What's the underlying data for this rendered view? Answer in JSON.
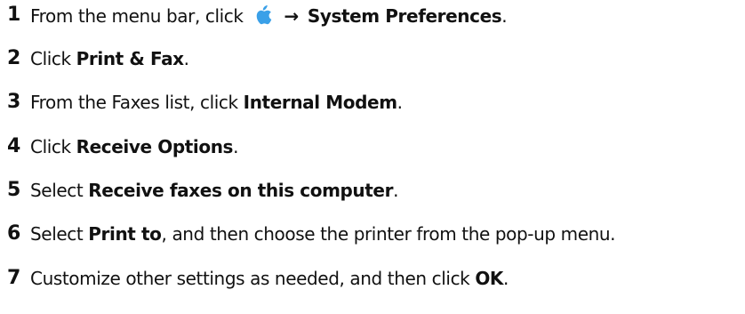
{
  "steps": [
    {
      "number": "1",
      "before": "From the menu bar, click",
      "icon": "apple-icon",
      "arrow": "→",
      "bold": "System Preferences",
      "after": "."
    },
    {
      "number": "2",
      "before": "Click",
      "bold": "Print & Fax",
      "after": "."
    },
    {
      "number": "3",
      "before": "From the Faxes list, click",
      "bold": "Internal Modem",
      "after": "."
    },
    {
      "number": "4",
      "before": "Click",
      "bold": "Receive Options",
      "after": "."
    },
    {
      "number": "5",
      "before": "Select",
      "bold": "Receive faxes on this computer",
      "after": "."
    },
    {
      "number": "6",
      "before": "Select",
      "bold": "Print to",
      "after": ", and then choose the printer from the pop-up menu."
    },
    {
      "number": "7",
      "before": "Customize other settings as needed, and then click",
      "bold": "OK",
      "after": "."
    }
  ],
  "colors": {
    "apple_icon": "#3aa0e8"
  }
}
